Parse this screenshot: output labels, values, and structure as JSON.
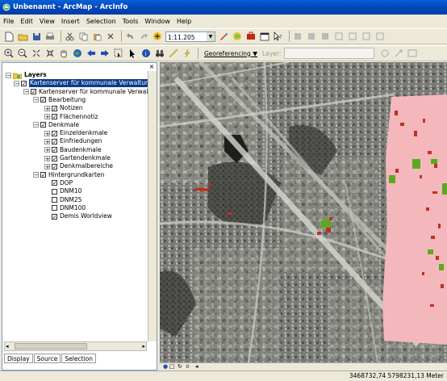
{
  "window": {
    "title": "Unbenannt - ArcMap - ArcInfo"
  },
  "menu": [
    "File",
    "Edit",
    "View",
    "Insert",
    "Selection",
    "Tools",
    "Window",
    "Help"
  ],
  "toolbar": {
    "scale": "1:11.205",
    "georeferencing": "Georeferencing ▼",
    "layer_label": "Layer:"
  },
  "toc": {
    "items": [
      {
        "label": "Layers",
        "level": 0,
        "bold": true,
        "expand": "−",
        "check": false,
        "folder": true
      },
      {
        "label": "Kartenserver für kommunale Verwaltungen",
        "level": 1,
        "expand": "−",
        "check": true,
        "selected": true
      },
      {
        "label": "Kartenserver für kommunale Verwaltun",
        "level": 2,
        "expand": "−",
        "check": true
      },
      {
        "label": "Bearbeitung",
        "level": 3,
        "expand": "−",
        "check": true
      },
      {
        "label": "Notizen",
        "level": 4,
        "expand": "+",
        "check": true
      },
      {
        "label": "Flächennotiz",
        "level": 4,
        "expand": "+",
        "check": true
      },
      {
        "label": "Denkmale",
        "level": 3,
        "expand": "−",
        "check": true
      },
      {
        "label": "Einzeldenkmale",
        "level": 4,
        "expand": "+",
        "check": true
      },
      {
        "label": "Einfriedungen",
        "level": 4,
        "expand": "+",
        "check": true
      },
      {
        "label": "Baudenkmale",
        "level": 4,
        "expand": "+",
        "check": true
      },
      {
        "label": "Gartendenkmale",
        "level": 4,
        "expand": "+",
        "check": true
      },
      {
        "label": "Denkmalbereiche",
        "level": 4,
        "expand": "+",
        "check": true
      },
      {
        "label": "Hintergrundkarten",
        "level": 3,
        "expand": "−",
        "check": true
      },
      {
        "label": "DOP",
        "level": 4,
        "expand": "",
        "check": true
      },
      {
        "label": "DNM10",
        "level": 4,
        "expand": "",
        "check": false
      },
      {
        "label": "DNM25",
        "level": 4,
        "expand": "",
        "check": false
      },
      {
        "label": "DNM100",
        "level": 4,
        "expand": "",
        "check": false
      },
      {
        "label": "Demis Worldview",
        "level": 4,
        "expand": "",
        "check": true
      }
    ],
    "tabs": [
      "Display",
      "Source",
      "Selection"
    ]
  },
  "status": {
    "coordinates": "3468732,74  5798231,13 Meter"
  },
  "colors": {
    "title_bar": "#0a5fd8",
    "selection": "#0a3c8c",
    "overlay_pink": "#f4b8bc",
    "monument_green": "#5ca820",
    "monument_red": "#c03020"
  }
}
